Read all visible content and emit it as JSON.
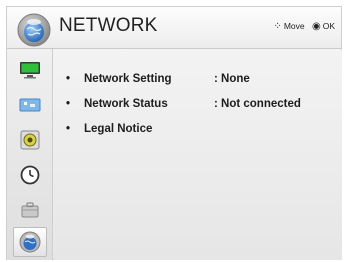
{
  "header": {
    "title": "NETWORK",
    "hints": [
      {
        "glyph": "⁘",
        "label": "Move",
        "icon": "move-arrows-icon"
      },
      {
        "glyph": "◉",
        "label": "OK",
        "icon": "ok-button-icon"
      }
    ]
  },
  "sidebar": {
    "items": [
      {
        "icon": "picture-icon"
      },
      {
        "icon": "screen-icon"
      },
      {
        "icon": "audio-icon"
      },
      {
        "icon": "time-icon"
      },
      {
        "icon": "option-icon"
      },
      {
        "icon": "network-icon",
        "active": true
      }
    ]
  },
  "menu": {
    "bullet": "•",
    "items": [
      {
        "label": "Network Setting",
        "value": ": None"
      },
      {
        "label": "Network Status",
        "value": ": Not connected"
      },
      {
        "label": "Legal Notice",
        "value": ""
      }
    ]
  },
  "colors": {
    "accent_blue": "#2f6fc4",
    "text": "#1d1d1d"
  }
}
